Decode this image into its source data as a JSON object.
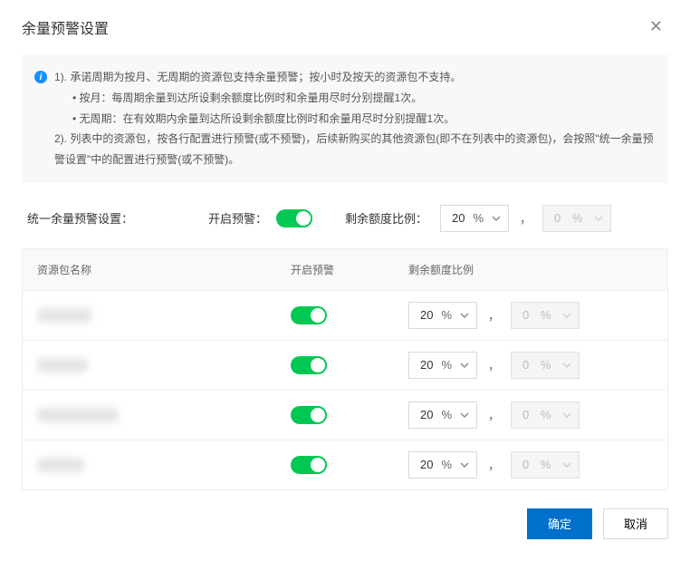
{
  "header": {
    "title": "余量预警设置"
  },
  "info": {
    "line1": "1). 承诺周期为按月、无周期的资源包支持余量预警；按小时及按天的资源包不支持。",
    "sub1": "• 按月：每周期余量到达所设剩余额度比例时和余量用尽时分别提醒1次。",
    "sub2": "• 无周期：在有效期内余量到达所设剩余额度比例时和余量用尽时分别提醒1次。",
    "line2": "2). 列表中的资源包，按各行配置进行预警(或不预警)，后续新购买的其他资源包(即不在列表中的资源包)，会按照\"统一余量预警设置\"中的配置进行预警(或不预警)。"
  },
  "uniform": {
    "label": "统一余量预警设置：",
    "enable_label": "开启预警：",
    "ratio_label": "剩余额度比例：",
    "val1": "20",
    "unit": "%",
    "val2": "0"
  },
  "table": {
    "h_name": "资源包名称",
    "h_toggle": "开启预警",
    "h_ratio": "剩余额度比例",
    "rows": [
      {
        "val1": "20",
        "unit": "%",
        "val2": "0",
        "namew": "60px"
      },
      {
        "val1": "20",
        "unit": "%",
        "val2": "0",
        "namew": "56px"
      },
      {
        "val1": "20",
        "unit": "%",
        "val2": "0",
        "namew": "90px"
      },
      {
        "val1": "20",
        "unit": "%",
        "val2": "0",
        "namew": "52px"
      }
    ]
  },
  "footer": {
    "ok": "确定",
    "cancel": "取消"
  }
}
